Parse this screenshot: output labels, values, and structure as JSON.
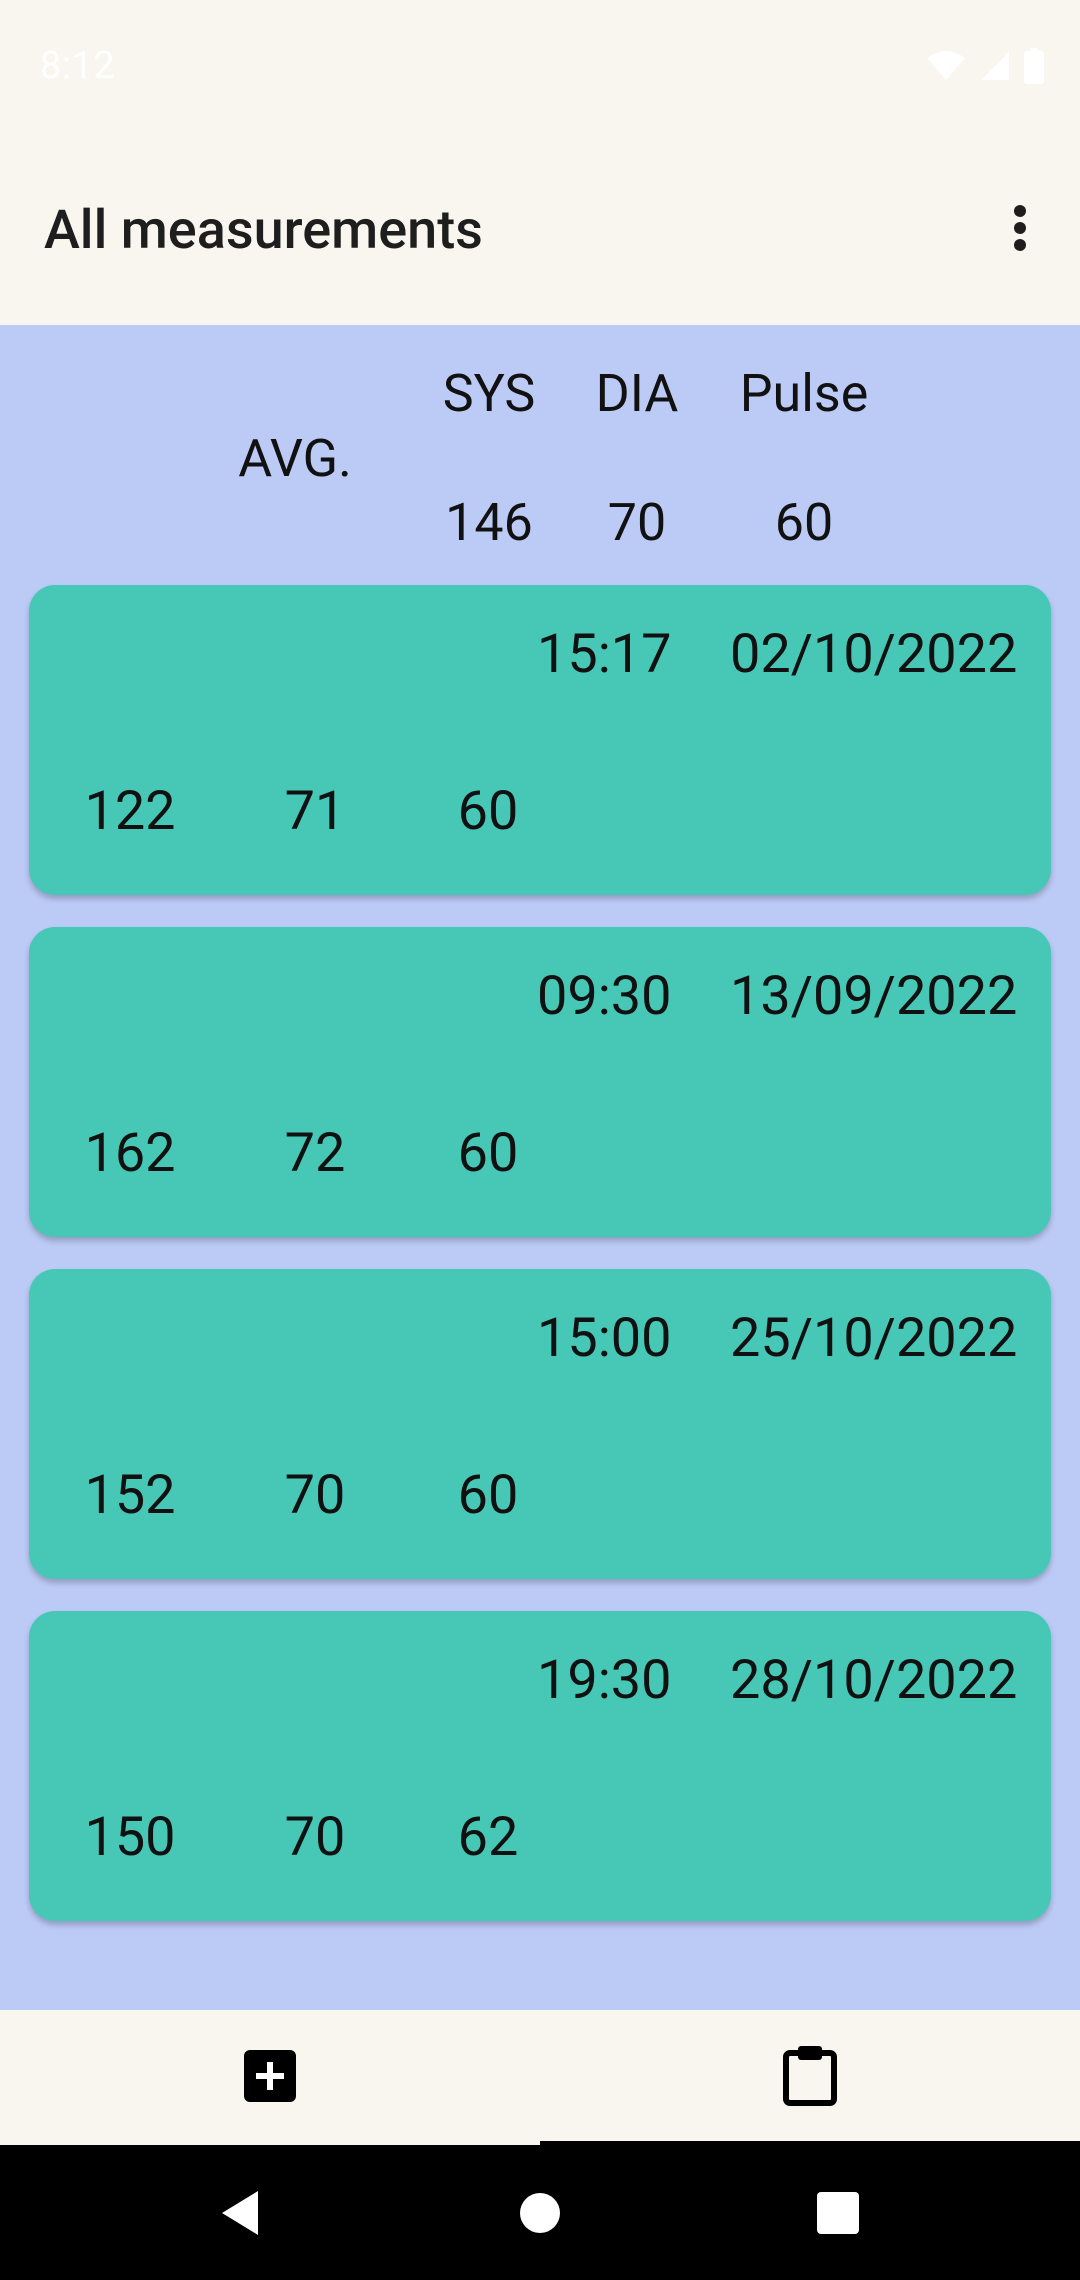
{
  "status_bar": {
    "time": "8:12",
    "icons": [
      "wifi-icon",
      "cell-signal-icon",
      "battery-icon"
    ]
  },
  "app_bar": {
    "title": "All measurements",
    "overflow_icon": "more-vert-icon"
  },
  "summary": {
    "avg_label": "AVG.",
    "sys_label": "SYS",
    "dia_label": "DIA",
    "pulse_label": "Pulse",
    "sys_value": "146",
    "dia_value": "70",
    "pulse_value": "60"
  },
  "measurements": [
    {
      "time": "15:17",
      "date": "02/10/2022",
      "sys": "122",
      "dia": "71",
      "pulse": "60"
    },
    {
      "time": "09:30",
      "date": "13/09/2022",
      "sys": "162",
      "dia": "72",
      "pulse": "60"
    },
    {
      "time": "15:00",
      "date": "25/10/2022",
      "sys": "152",
      "dia": "70",
      "pulse": "60"
    },
    {
      "time": "19:30",
      "date": "28/10/2022",
      "sys": "150",
      "dia": "70",
      "pulse": "62"
    }
  ],
  "bottom_nav": {
    "items": [
      {
        "icon": "add-box-icon",
        "selected": false
      },
      {
        "icon": "clipboard-icon",
        "selected": true
      }
    ]
  },
  "system_nav": {
    "icons": [
      "back-icon",
      "home-icon",
      "recents-icon"
    ]
  },
  "colors": {
    "background": "#BCCAF6",
    "card": "#47C8B6",
    "app_bar": "#F8F6EF"
  }
}
